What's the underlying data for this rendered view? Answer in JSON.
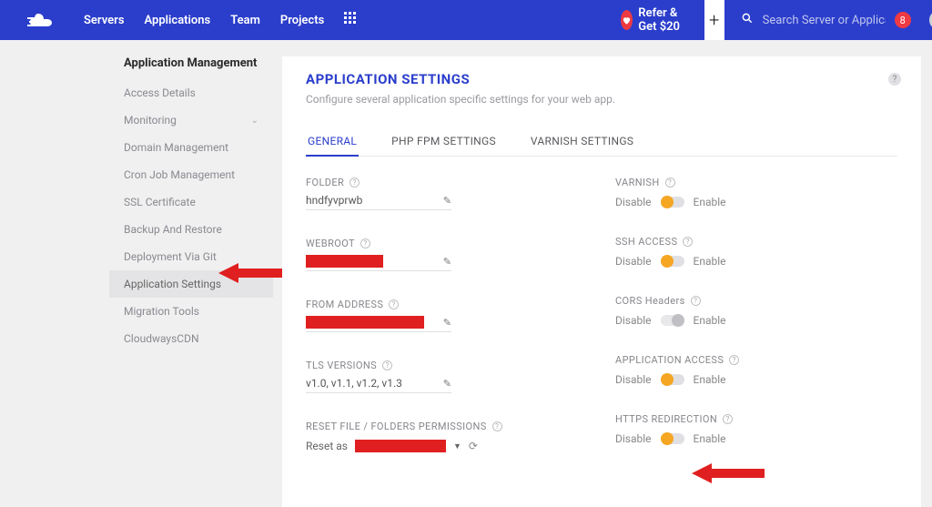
{
  "topnav": {
    "servers": "Servers",
    "applications": "Applications",
    "team": "Team",
    "projects": "Projects"
  },
  "refer": {
    "label": "Refer & Get $20"
  },
  "search": {
    "placeholder": "Search Server or Application",
    "badge": "8"
  },
  "sidebar": {
    "title": "Application Management",
    "items": [
      {
        "label": "Access Details"
      },
      {
        "label": "Monitoring",
        "chevron": true
      },
      {
        "label": "Domain Management"
      },
      {
        "label": "Cron Job Management"
      },
      {
        "label": "SSL Certificate"
      },
      {
        "label": "Backup And Restore"
      },
      {
        "label": "Deployment Via Git"
      },
      {
        "label": "Application Settings",
        "active": true
      },
      {
        "label": "Migration Tools"
      },
      {
        "label": "CloudwaysCDN"
      }
    ]
  },
  "header": {
    "title": "APPLICATION SETTINGS",
    "subtitle": "Configure several application specific settings for your web app."
  },
  "tabs": {
    "general": "GENERAL",
    "php": "PHP FPM SETTINGS",
    "varnish": "VARNISH SETTINGS"
  },
  "left": {
    "folder": {
      "label": "FOLDER",
      "value": "hndfyvprwb"
    },
    "webroot": {
      "label": "WEBROOT"
    },
    "from": {
      "label": "FROM ADDRESS"
    },
    "tls": {
      "label": "TLS VERSIONS",
      "value": "v1.0, v1.1, v1.2, v1.3"
    },
    "reset": {
      "label": "RESET FILE / FOLDERS PERMISSIONS",
      "prefix": "Reset as"
    }
  },
  "right": {
    "disable": "Disable",
    "enable": "Enable",
    "varnish": {
      "label": "VARNISH"
    },
    "ssh": {
      "label": "SSH ACCESS"
    },
    "cors": {
      "label": "CORS Headers"
    },
    "appaccess": {
      "label": "APPLICATION ACCESS"
    },
    "https": {
      "label": "HTTPS REDIRECTION"
    }
  }
}
